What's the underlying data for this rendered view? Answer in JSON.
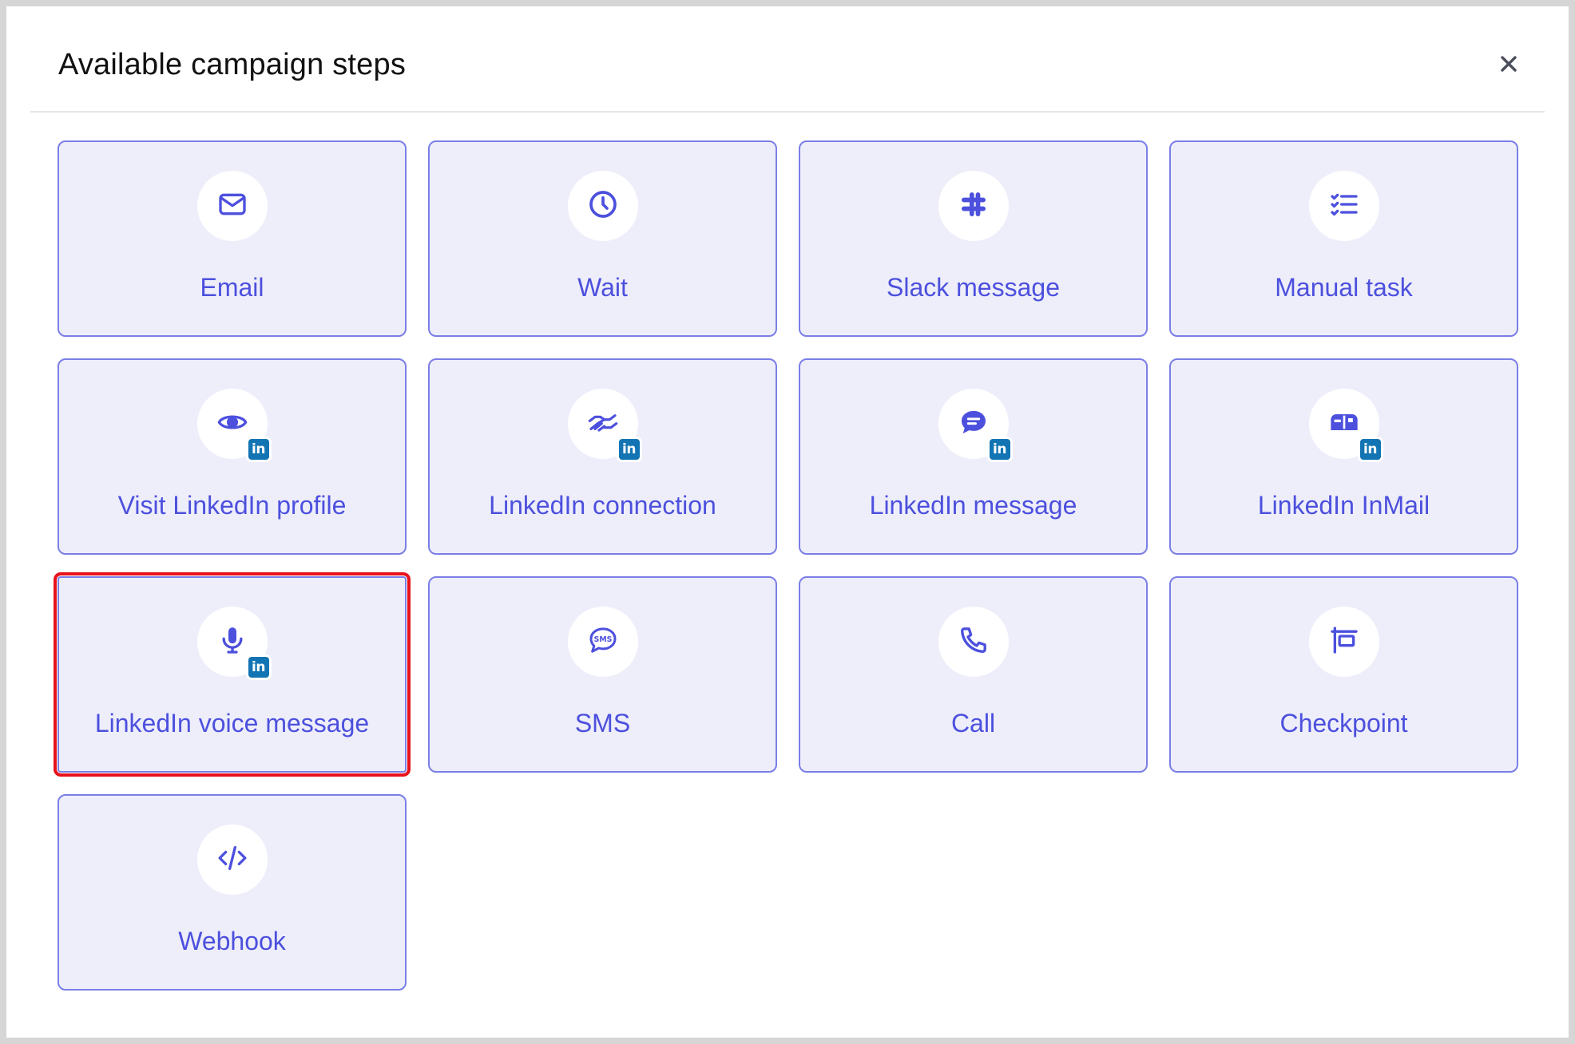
{
  "modal": {
    "title": "Available campaign steps",
    "close_icon": "close-icon"
  },
  "colors": {
    "accent": "#4c50dd",
    "card_background": "#eeeefb",
    "card_border": "#7a7ee6",
    "linkedin_badge": "#1274b3",
    "selection_outline": "#e8121a"
  },
  "linkedin_badge_text": "in",
  "steps": [
    {
      "label": "Email",
      "icon": "envelope-icon",
      "linkedin": false
    },
    {
      "label": "Wait",
      "icon": "clock-icon",
      "linkedin": false
    },
    {
      "label": "Slack message",
      "icon": "slack-icon",
      "linkedin": false
    },
    {
      "label": "Manual task",
      "icon": "checklist-icon",
      "linkedin": false
    },
    {
      "label": "Visit LinkedIn profile",
      "icon": "eye-icon",
      "linkedin": true
    },
    {
      "label": "LinkedIn connection",
      "icon": "handshake-icon",
      "linkedin": true
    },
    {
      "label": "LinkedIn message",
      "icon": "chat-bubble-icon",
      "linkedin": true
    },
    {
      "label": "LinkedIn InMail",
      "icon": "mailbox-icon",
      "linkedin": true
    },
    {
      "label": "LinkedIn voice message",
      "icon": "microphone-icon",
      "linkedin": true,
      "selected": true
    },
    {
      "label": "SMS",
      "icon": "sms-bubble-icon",
      "linkedin": false
    },
    {
      "label": "Call",
      "icon": "phone-icon",
      "linkedin": false
    },
    {
      "label": "Checkpoint",
      "icon": "checkpoint-sign-icon",
      "linkedin": false
    },
    {
      "label": "Webhook",
      "icon": "code-icon",
      "linkedin": false
    }
  ]
}
